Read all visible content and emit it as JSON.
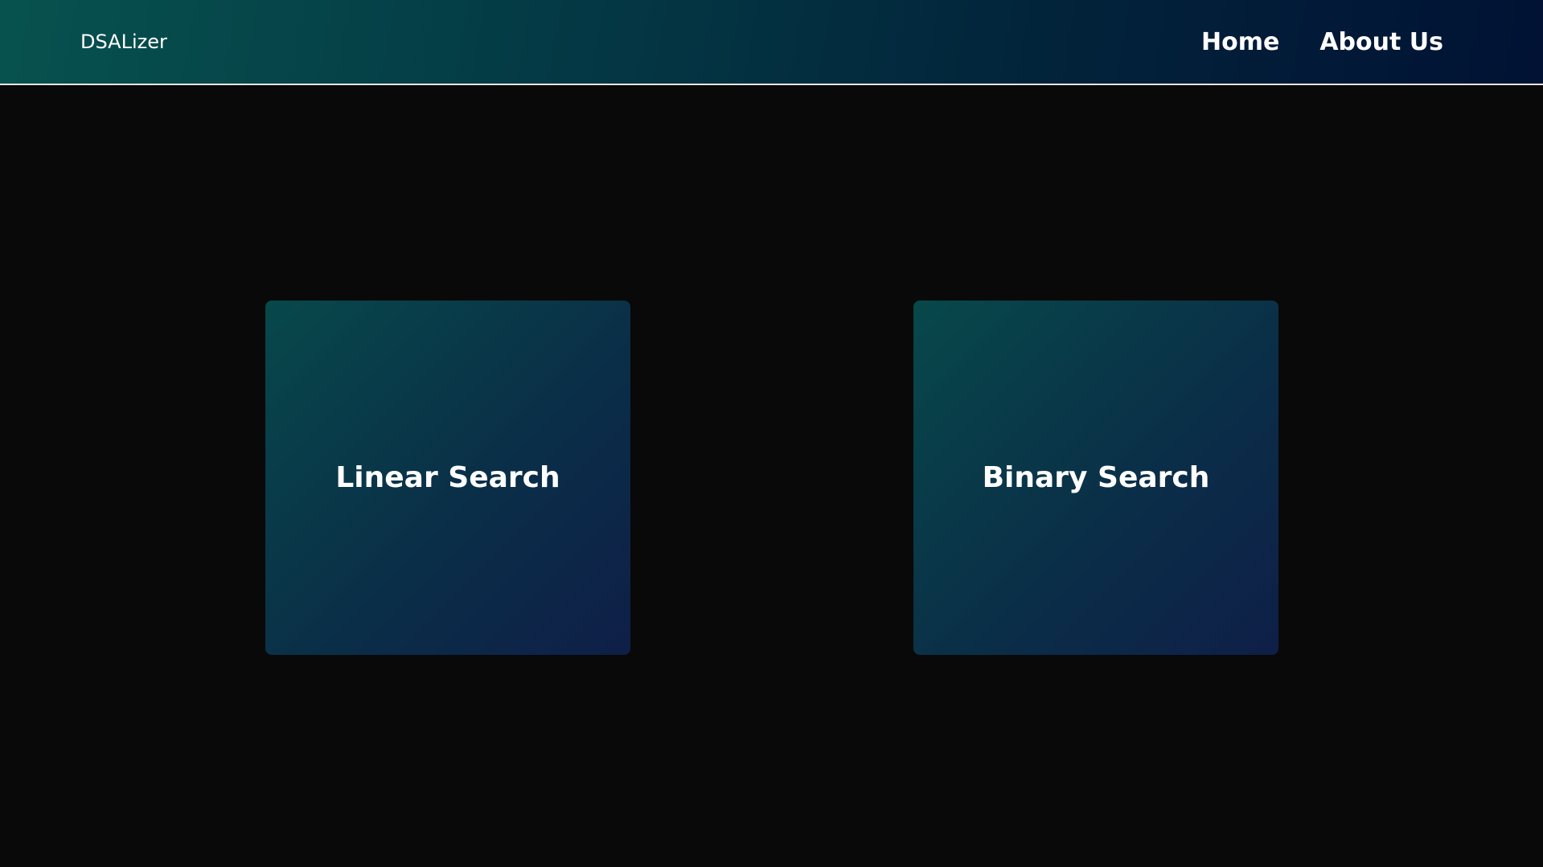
{
  "header": {
    "brand": "DSALizer",
    "nav": [
      {
        "label": "Home"
      },
      {
        "label": "About Us"
      }
    ]
  },
  "cards": [
    {
      "label": "Linear Search"
    },
    {
      "label": "Binary Search"
    }
  ],
  "colors": {
    "page_background": "#090909",
    "header_gradient_start": "#07524f",
    "header_gradient_end": "#011234",
    "card_gradient_start": "#07484a",
    "card_gradient_end": "#0f1f48",
    "text": "#ffffff",
    "header_border": "#e6e6e6"
  }
}
